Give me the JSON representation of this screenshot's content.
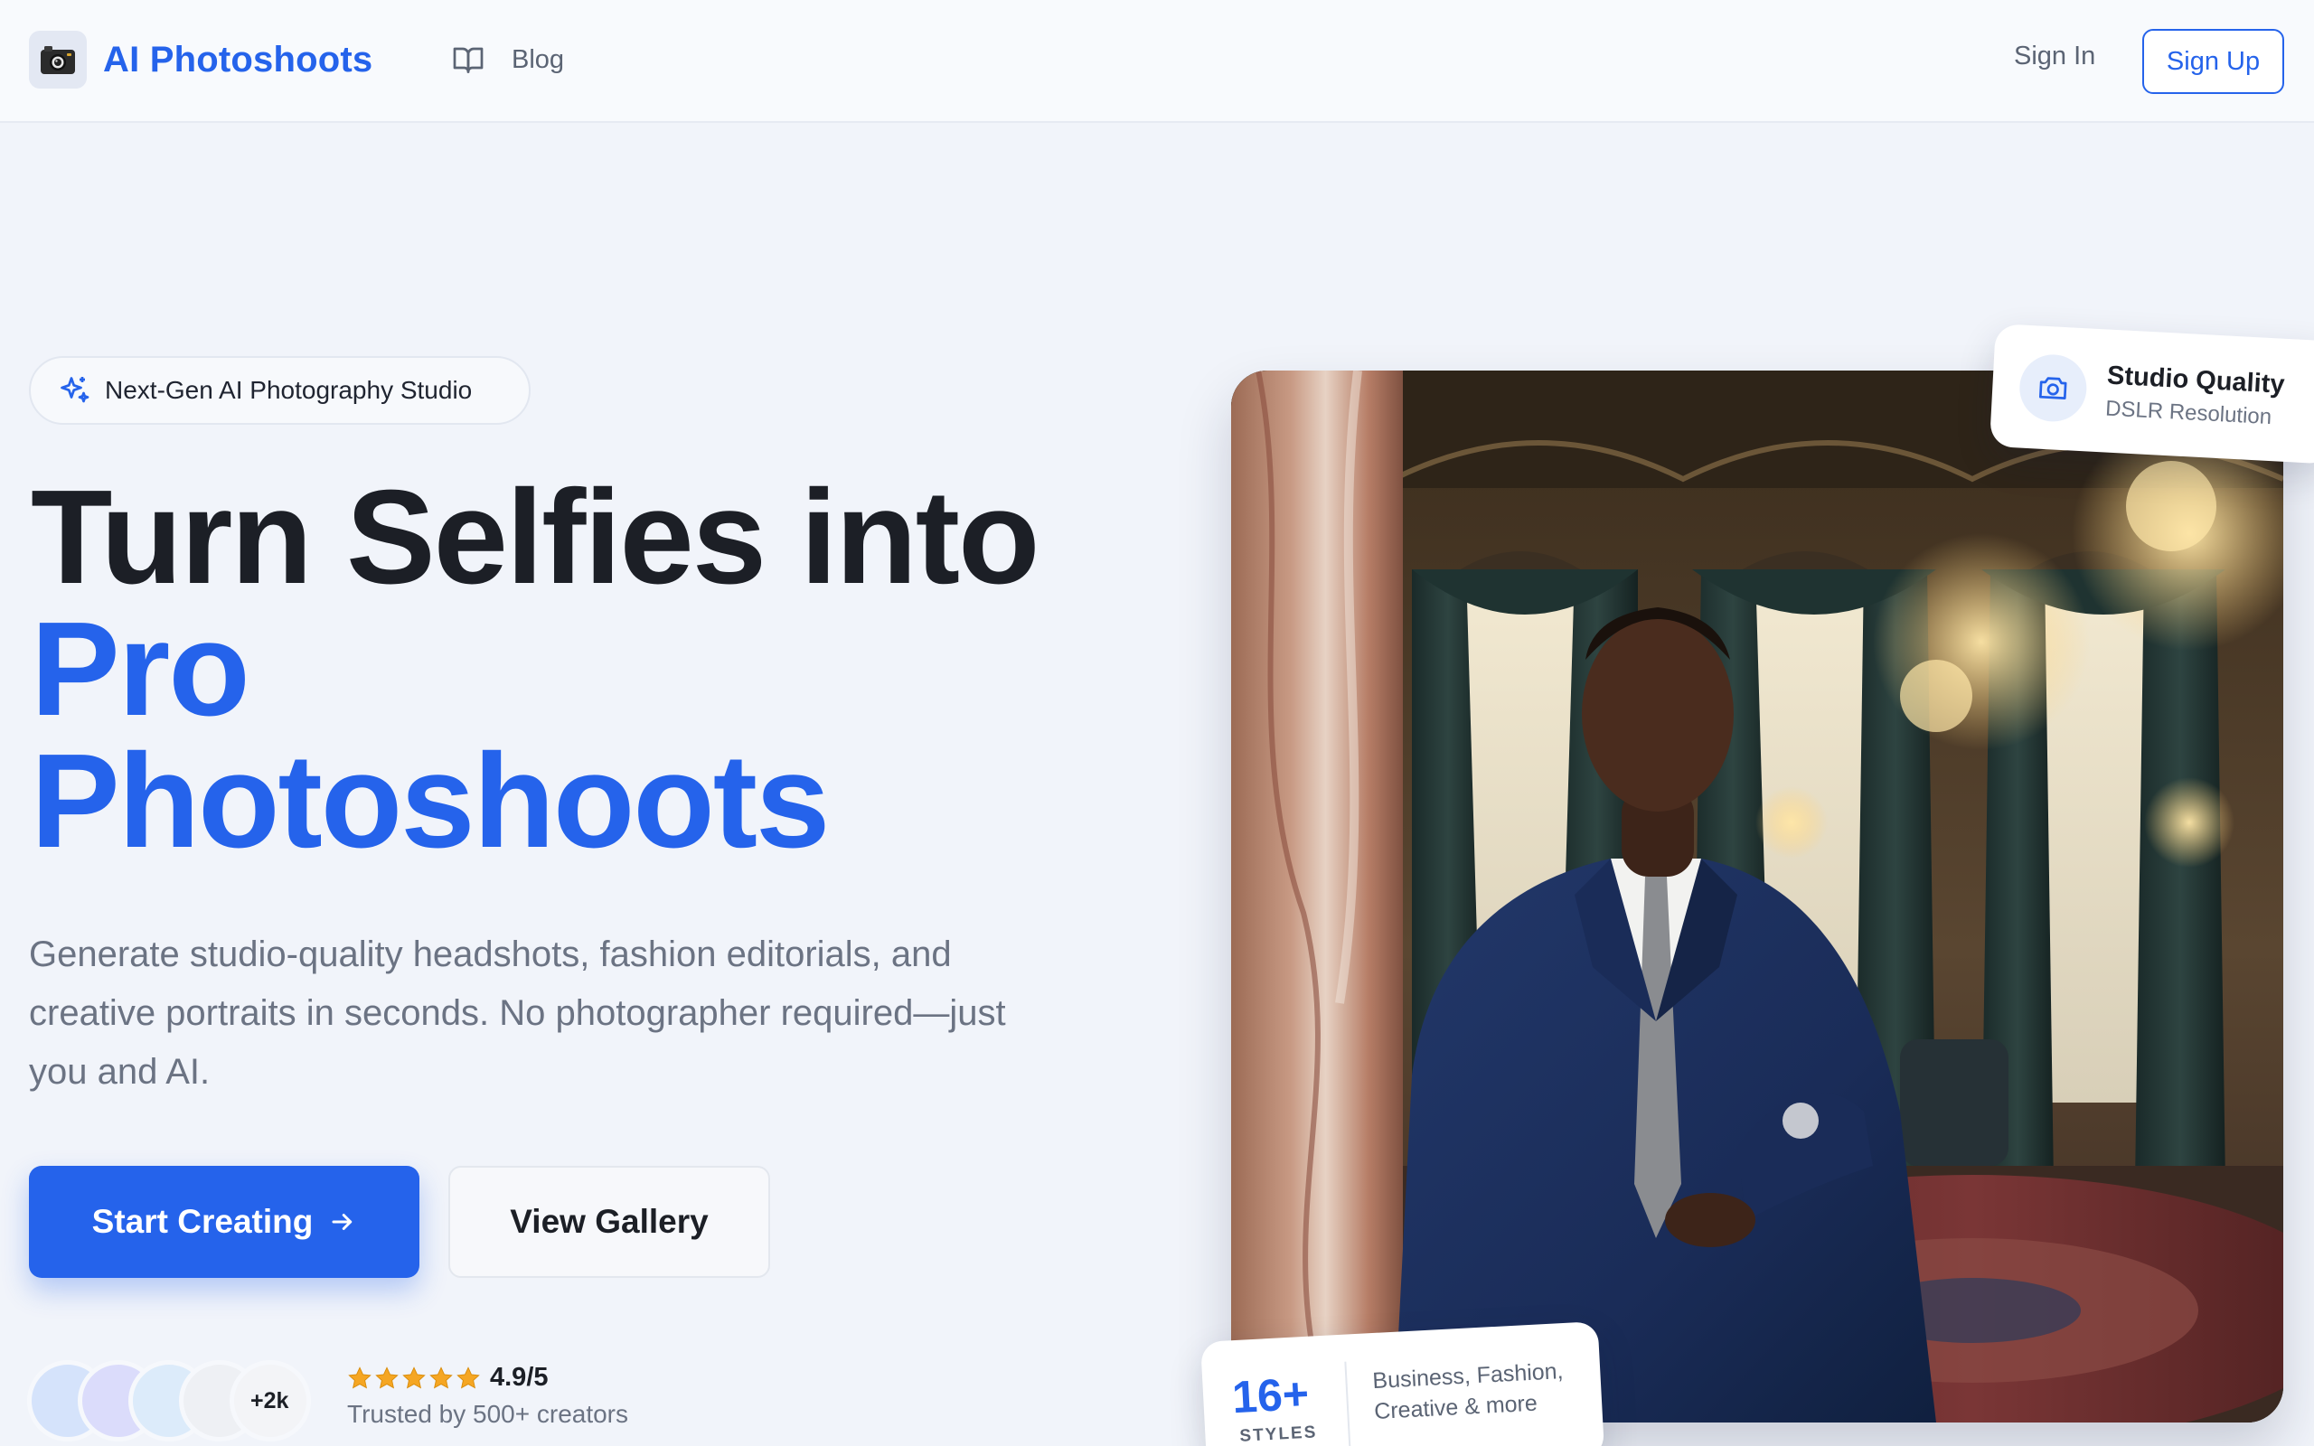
{
  "header": {
    "brand": "AI Photoshoots",
    "logo_icon": "camera-icon",
    "nav": [
      {
        "label": "Blog",
        "icon": "book-icon"
      }
    ],
    "sign_in": "Sign In",
    "sign_up": "Sign Up"
  },
  "hero": {
    "badge": "Next-Gen AI Photography Studio",
    "badge_icon": "sparkle-icon",
    "headline_line1": "Turn Selfies into",
    "headline_line2": "Pro",
    "headline_line3": "Photoshoots",
    "subtext": "Generate studio-quality headshots, fashion editorials, and creative portraits in seconds. No photographer required—just you and AI.",
    "primary_cta": "Start Creating",
    "secondary_cta": "View Gallery",
    "avatar_count": "+2k",
    "rating": "4.9/5",
    "trust_text": "Trusted by 500+ creators"
  },
  "cards": {
    "quality_title": "Studio Quality",
    "quality_subtitle": "DSLR Resolution",
    "styles_count": "16+",
    "styles_label": "STYLES",
    "styles_desc": "Business, Fashion, Creative & more"
  },
  "colors": {
    "accent": "#2563eb",
    "background": "#f1f4fa",
    "text_dark": "#1c1f26",
    "text_muted": "#6b7383",
    "star": "#f5a623"
  }
}
